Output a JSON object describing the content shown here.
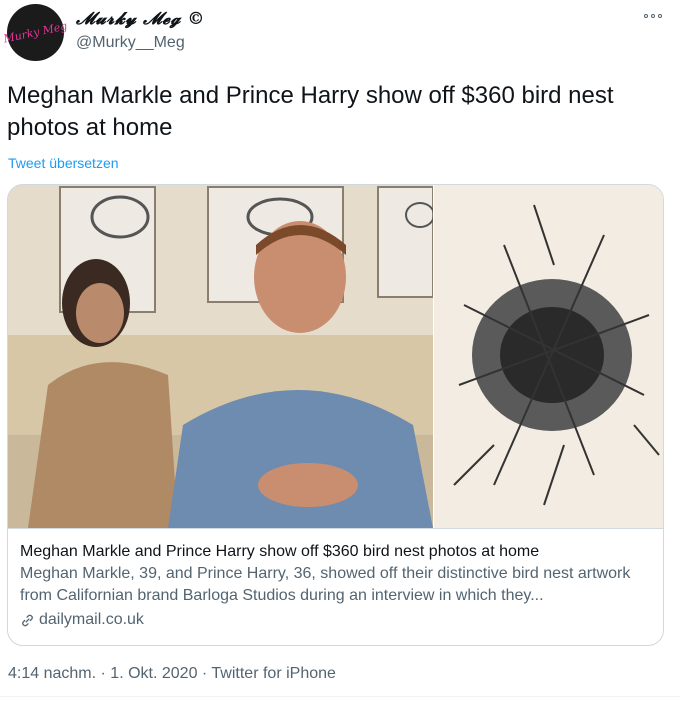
{
  "author": {
    "avatar_text": "Murky Meg",
    "display_name": "𝓜𝓾𝓻𝓴𝔂 𝓜𝓮𝓰 ©",
    "handle": "@Murky__Meg"
  },
  "more_icon": "more-horizontal-icon",
  "tweet": {
    "text": "Meghan Markle and Prince Harry show off $360 bird nest photos at home",
    "translate_label": "Tweet übersetzen"
  },
  "card": {
    "title": "Meghan Markle and Prince Harry show off $360 bird nest photos at home",
    "description": "Meghan Markle, 39, and Prince Harry, 36, showed off their distinctive bird nest artwork from Californian brand Barloga Studios during an interview in which they...",
    "domain": "dailymail.co.uk",
    "domain_icon": "link-icon"
  },
  "meta": {
    "time": "4:14 nachm.",
    "separator": "·",
    "date": "1. Okt. 2020",
    "source": "Twitter for iPhone"
  },
  "colors": {
    "link": "#1d9bf0",
    "secondary_text": "#536471",
    "border": "#cfd9de",
    "avatar_bg": "#1b1b1b",
    "avatar_accent": "#e2349a"
  }
}
